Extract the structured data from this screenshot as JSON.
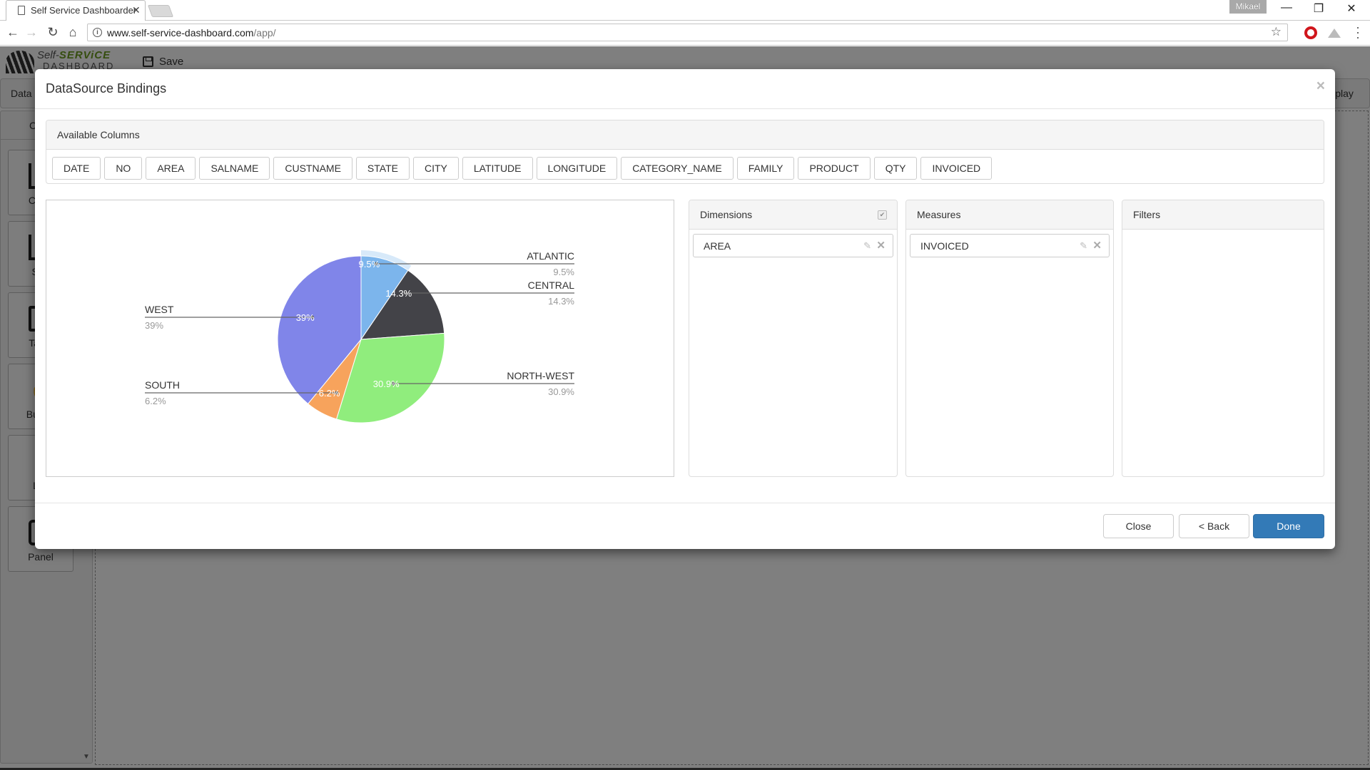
{
  "browser": {
    "tab_title": "Self Service Dashboarder",
    "url_host": "www.self-service-dashboard.com",
    "url_path": "/app/",
    "profile_name": "Mikael"
  },
  "app": {
    "logo_line1_prefix": "Self-",
    "logo_line1_brand": "SERViCE",
    "logo_line2": "DASHBOARD",
    "save_label": "Save",
    "tab_data_label": "Data",
    "sidebar_header": "Controls",
    "display_label": "Display",
    "widgets": [
      {
        "label": "Chart",
        "icon": "bar-chart-icon"
      },
      {
        "label": "Stat",
        "icon": "bar-chart-icon"
      },
      {
        "label": "Table",
        "icon": "table-icon"
      },
      {
        "label": "Button",
        "icon": "hand-pointer-icon"
      },
      {
        "label": "List",
        "icon": "list-icon"
      },
      {
        "label": "Panel",
        "icon": "panel-icon"
      }
    ]
  },
  "modal": {
    "title": "DataSource Bindings",
    "close_glyph": "×",
    "available_columns": {
      "heading": "Available Columns",
      "columns": [
        "DATE",
        "NO",
        "AREA",
        "SALNAME",
        "CUSTNAME",
        "STATE",
        "CITY",
        "LATITUDE",
        "LONGITUDE",
        "CATEGORY_NAME",
        "FAMILY",
        "PRODUCT",
        "QTY",
        "INVOICED"
      ]
    },
    "dimensions": {
      "heading": "Dimensions",
      "checked": true,
      "items": [
        {
          "label": "AREA"
        }
      ]
    },
    "measures": {
      "heading": "Measures",
      "items": [
        {
          "label": "INVOICED"
        }
      ]
    },
    "filters": {
      "heading": "Filters",
      "items": []
    },
    "footer": {
      "close_label": "Close",
      "back_label": "< Back",
      "done_label": "Done"
    }
  },
  "chart_data": {
    "type": "pie",
    "title": "",
    "dimension": "AREA",
    "measure": "INVOICED",
    "hovered": "ATLANTIC",
    "slices": [
      {
        "label": "ATLANTIC",
        "value": 9.5,
        "display": "9.5%",
        "color": "#7cb5ec"
      },
      {
        "label": "CENTRAL",
        "value": 14.3,
        "display": "14.3%",
        "color": "#434348"
      },
      {
        "label": "NORTH-WEST",
        "value": 30.9,
        "display": "30.9%",
        "color": "#90ed7d"
      },
      {
        "label": "SOUTH",
        "value": 6.2,
        "display": "6.2%",
        "color": "#f7a35c"
      },
      {
        "label": "WEST",
        "value": 39,
        "display": "39%",
        "color": "#8085e9"
      }
    ]
  }
}
